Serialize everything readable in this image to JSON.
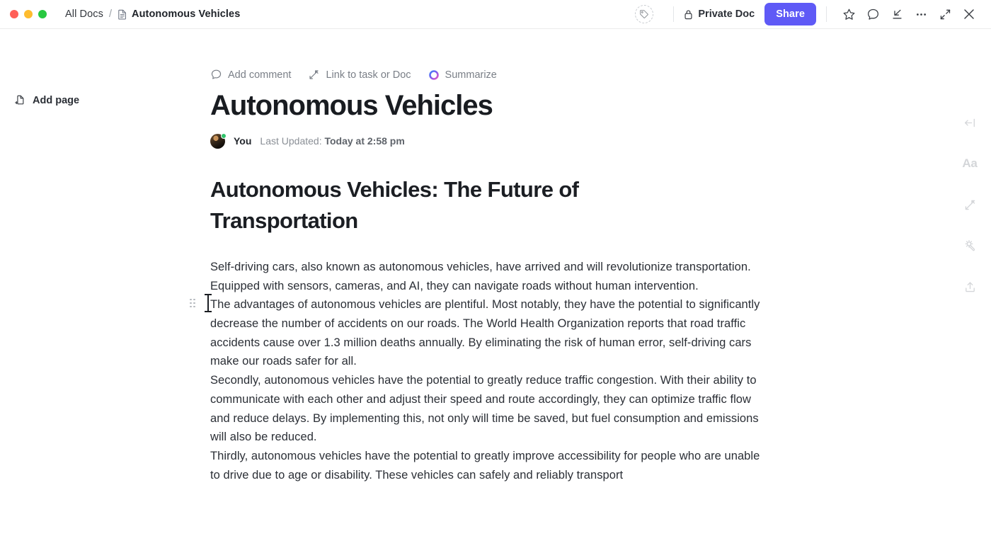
{
  "window": {
    "traffic_lights": [
      {
        "name": "close",
        "color": "#ff5f57"
      },
      {
        "name": "minimize",
        "color": "#febc2e"
      },
      {
        "name": "zoom",
        "color": "#28c840"
      }
    ]
  },
  "header": {
    "breadcrumb": {
      "root": "All Docs",
      "separator": "/",
      "current": "Autonomous Vehicles",
      "doc_icon": "document-icon"
    },
    "tag_icon": "tag-icon",
    "privacy": {
      "label": "Private Doc",
      "icon": "lock-icon"
    },
    "share_label": "Share",
    "share_color": "#5f5af6",
    "actions": [
      {
        "name": "favorite-star-icon",
        "label": "Star"
      },
      {
        "name": "comment-icon",
        "label": "Comments"
      },
      {
        "name": "download-icon",
        "label": "Download"
      },
      {
        "name": "more-options-icon",
        "label": "More"
      },
      {
        "name": "collapse-icon",
        "label": "Collapse"
      },
      {
        "name": "close-icon",
        "label": "Close"
      }
    ]
  },
  "sidebar": {
    "add_page_label": "Add page",
    "add_page_icon": "add-page-icon"
  },
  "right_rail": {
    "items": [
      {
        "name": "collapse-sidebar-icon",
        "label": "Collapse panel"
      },
      {
        "name": "font-size-icon",
        "label": "Aa"
      },
      {
        "name": "link-icon",
        "label": "Relationships"
      },
      {
        "name": "magic-wand-icon",
        "label": "AI"
      },
      {
        "name": "share-upload-icon",
        "label": "Share"
      }
    ]
  },
  "doc_toolbar": [
    {
      "name": "add-comment",
      "label": "Add comment",
      "icon": "comment-icon"
    },
    {
      "name": "link-to-task",
      "label": "Link to task or Doc",
      "icon": "link-icon"
    },
    {
      "name": "summarize",
      "label": "Summarize",
      "icon": "ai-gradient-icon"
    }
  ],
  "document": {
    "title": "Autonomous Vehicles",
    "author": "You",
    "updated_prefix": "Last Updated:",
    "updated_value": "Today at 2:58 pm",
    "heading": "Autonomous Vehicles: The Future of Transportation",
    "paragraphs": [
      "Self-driving cars, also known as autonomous vehicles, have arrived and will revolutionize transportation. Equipped with sensors, cameras, and AI, they can navigate roads without human intervention.",
      "The advantages of autonomous vehicles are plentiful. Most notably, they have the potential to significantly decrease the number of accidents on our roads. The World Health Organization reports that road traffic accidents cause over 1.3 million deaths annually. By eliminating the risk of human error, self-driving cars make our roads safer for all.",
      "Secondly, autonomous vehicles have the potential to greatly reduce traffic congestion. With their ability to communicate with each other and adjust their speed and route accordingly, they can optimize traffic flow and reduce delays. By implementing this, not only will time be saved, but fuel consumption and emissions will also be reduced.",
      "Thirdly, autonomous vehicles have the potential to greatly improve accessibility for people who are unable to drive due to age or disability. These vehicles can safely and reliably transport"
    ],
    "block_controls": {
      "add_block": "+",
      "drag_handle": "drag-handle-icon"
    }
  }
}
